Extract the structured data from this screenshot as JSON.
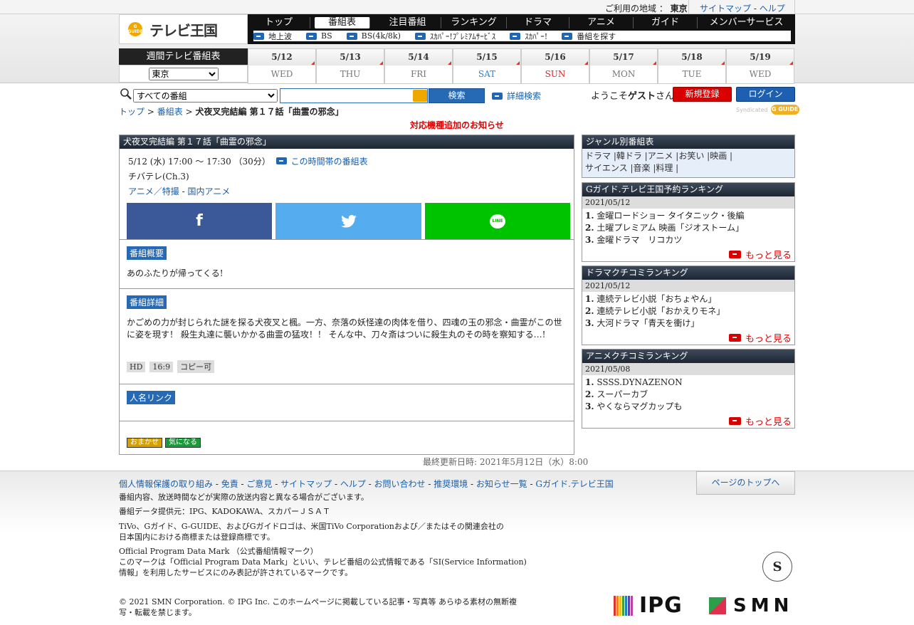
{
  "header": {
    "region_label": "ご利用の地域 ：",
    "region_value": "東京",
    "sitemap": "サイトマップ",
    "help": "ヘルプ",
    "logo_badge": "G GUIDE",
    "logo_text": "テレビ王国",
    "nav": [
      "トップ",
      "番組表",
      "注目番組",
      "ランキング",
      "ドラマ",
      "アニメ",
      "ガイド",
      "メンバーサービス"
    ],
    "subnav": [
      "地上波",
      "BS",
      "BS(4k/8k)",
      "ｽｶﾊﾟｰ!ﾌﾟﾚﾐｱﾑｻｰﾋﾞｽ",
      "ｽｶﾊﾟｰ!",
      "番組を探す"
    ]
  },
  "week": {
    "title": "週間テレビ番組表",
    "region_select": "東京",
    "days": [
      {
        "date": "5/12",
        "dow": "WED"
      },
      {
        "date": "5/13",
        "dow": "THU"
      },
      {
        "date": "5/14",
        "dow": "FRI"
      },
      {
        "date": "5/15",
        "dow": "SAT"
      },
      {
        "date": "5/16",
        "dow": "SUN"
      },
      {
        "date": "5/17",
        "dow": "MON"
      },
      {
        "date": "5/18",
        "dow": "TUE"
      },
      {
        "date": "5/19",
        "dow": "WED"
      }
    ]
  },
  "search": {
    "genre_select": "すべての番組",
    "button": "検索",
    "detail": "詳細検索",
    "welcome_pre": "ようこそ",
    "welcome_user": "ゲスト",
    "welcome_post": "さん",
    "register": "新規登録",
    "login": "ログイン",
    "syndicated": "Syndicated",
    "syndicated_badge": "G GUIDE"
  },
  "breadcrumb": {
    "top": "トップ",
    "sep": ">",
    "guide": "番組表",
    "current": "犬夜叉完結編 第１７話「曲霊の邪念」"
  },
  "notice": "対応機種追加のお知らせ",
  "program": {
    "title": "犬夜叉完結編 第１７話「曲霊の邪念」",
    "time": "5/12 (水) 17:00 ～ 17:30 （30分）",
    "slot_link": "この時間帯の番組表",
    "channel": "チバテレ(Ch.3)",
    "genre1": "アニメ／特撮",
    "genre_sep": "-",
    "genre2": "国内アニメ",
    "share": {
      "facebook": "f",
      "line": "LINE"
    },
    "summary_label": "番組概要",
    "summary": "あのふたりが帰ってくる!",
    "detail_label": "番組詳細",
    "detail": "かごめの力が封じられた謎を探る犬夜叉と楓。一方、奈落の妖怪達の肉体を借り、四魂の玉の邪念・曲霊がこの世に姿を現す！ 殺生丸達に襲いかかる曲霊の猛攻！！ そんな中、刀々斎はついに殺生丸のその時を察知する…!",
    "tags": [
      "HD",
      "16:9",
      "コピー可"
    ],
    "people_label": "人名リンク",
    "omakase": "おまかせ",
    "kininaru": "気になる",
    "last_updated": "最終更新日時: 2021年5月12日（水）8:00"
  },
  "sidebar": {
    "genre_title": "ジャンル別番組表",
    "genres_line1": "ドラマ |韓ドラ |アニメ |お笑い |映画 |",
    "genres_line2": "サイエンス |音楽 |料理 |",
    "rankings": [
      {
        "title": "Gガイド.テレビ王国予約ランキング",
        "date": "2021/05/12",
        "items": [
          "金曜ロードショー タイタニック・後編",
          "土曜プレミアム 映画「ジオストーム」",
          "金曜ドラマ　リコカツ"
        ],
        "more": "もっと見る"
      },
      {
        "title": "ドラマクチコミランキング",
        "date": "2021/05/12",
        "items": [
          "連続テレビ小説「おちょやん」",
          "連続テレビ小説「おかえりモネ」",
          "大河ドラマ「青天を衝け」"
        ],
        "more": "もっと見る"
      },
      {
        "title": "アニメクチコミランキング",
        "date": "2021/05/08",
        "items": [
          "SSSS.DYNAZENON",
          "スーパーカブ",
          "やくならマグカップも"
        ],
        "more": "もっと見る"
      }
    ]
  },
  "footer": {
    "links": [
      "個人情報保護の取り組み",
      "免責",
      "ご意見",
      "サイトマップ",
      "ヘルプ",
      "お問い合わせ",
      "推奨環境",
      "お知らせ一覧",
      "Gガイド.テレビ王国"
    ],
    "page_top": "ページのトップへ",
    "note1": "番組内容、放送時間などが実際の放送内容と異なる場合がございます。",
    "note2": "番組データ提供元：IPG、KADOKAWA、スカパーＪＳＡＴ",
    "tm1": "TiVo、Gガイド、G-GUIDE、およびGガイドロゴは、米国TiVo Corporationおよび／またはその関連会社の",
    "tm2": "日本国内における商標または登録商標です。",
    "mark1": "Official Program Data Mark （公式番組情報マーク）",
    "mark2": "このマークは「Official Program Data Mark」といい、テレビ番組の公式情報である「SI(Service Information)",
    "mark3": "情報」を利用したサービスにのみ表記が許されているマークです。",
    "copy1": "© 2021 SMN Corporation. © IPG Inc. このホームページに掲載している記事・写真等 あらゆる素材の無断複",
    "copy2": "写・転載を禁じます。",
    "seal": "S",
    "ipg": "IPG",
    "smn": "SMN"
  }
}
